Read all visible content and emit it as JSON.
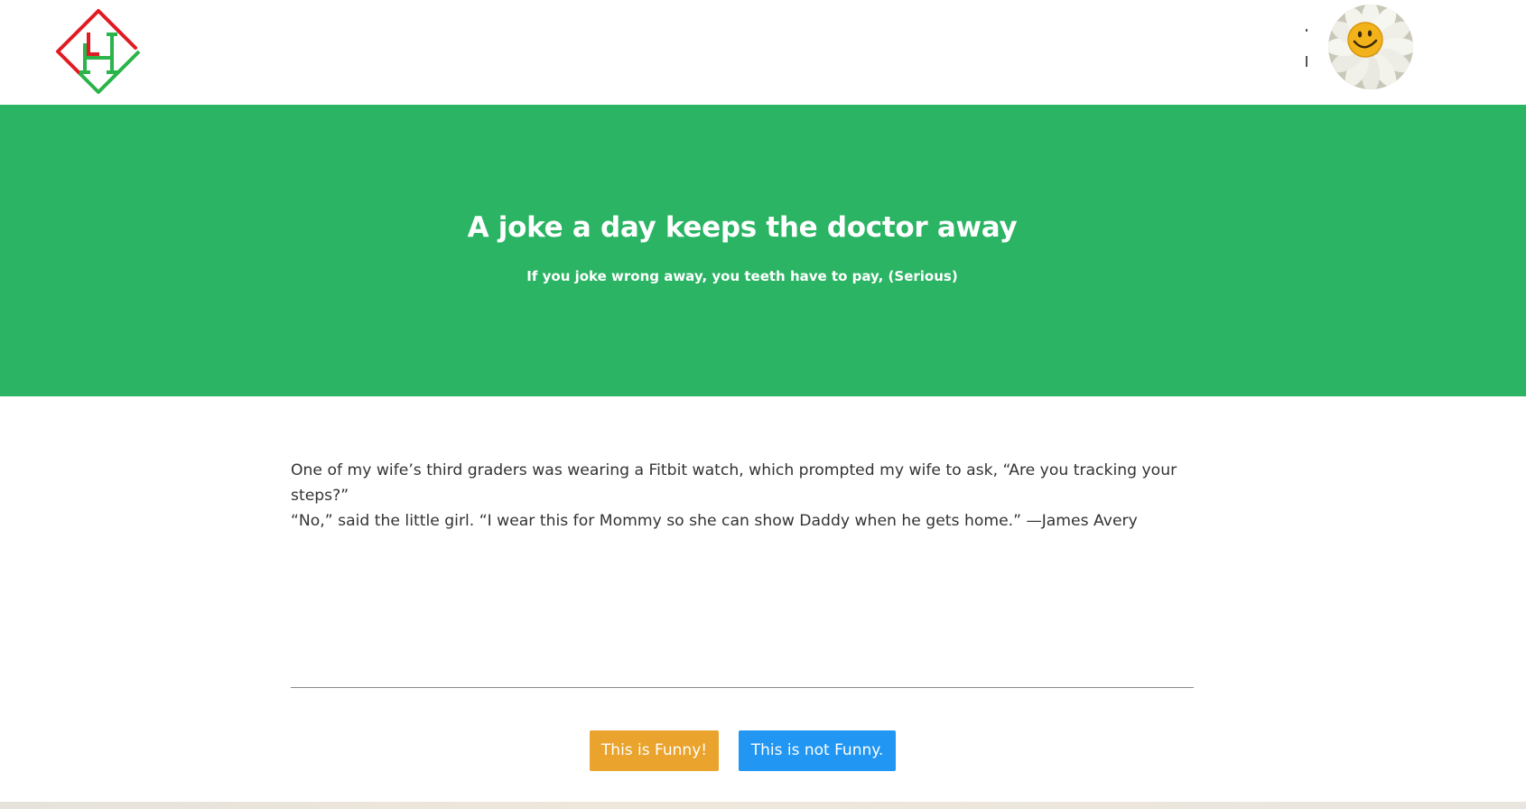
{
  "header": {
    "logo_icon": "lh-diamond-logo-icon",
    "logo_letters": "LH",
    "avatar_icon": "smiley-flower-avatar-icon"
  },
  "hero": {
    "title": "A joke a day keeps the doctor away",
    "subtitle": "If you joke wrong away, you teeth have to pay, (Serious)",
    "background_color": "#2bb464"
  },
  "joke": {
    "line1": "One of my wife’s third graders was wearing a Fitbit watch, which prompted my wife to ask, “Are you tracking your steps?”",
    "line2": "“No,” said the little girl. “I wear this for Mommy so she can show Daddy when he gets home.” —James Avery"
  },
  "actions": {
    "funny_label": "This is Funny!",
    "not_funny_label": "This is not Funny.",
    "funny_color": "#eaa32c",
    "not_funny_color": "#2196f3"
  }
}
